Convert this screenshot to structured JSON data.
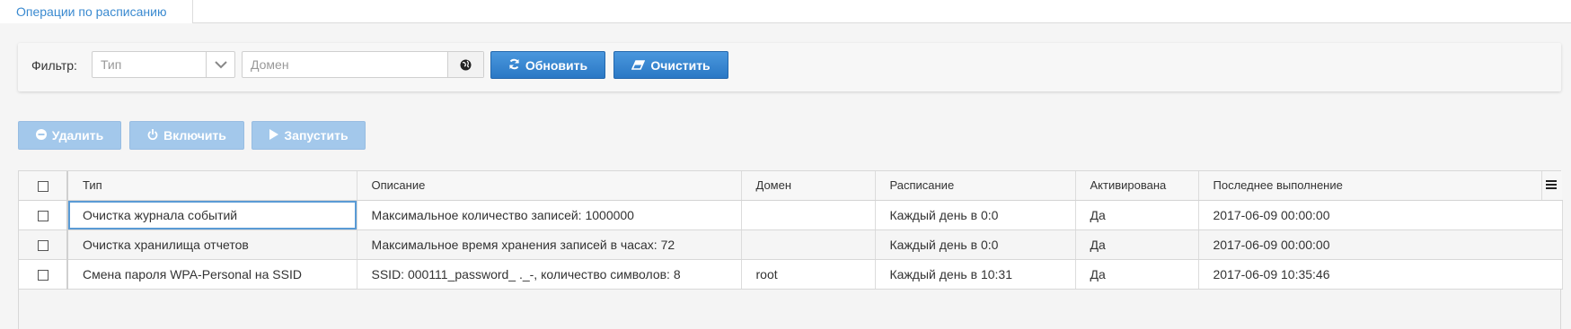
{
  "tab": {
    "label": "Операции по расписанию"
  },
  "filter": {
    "label": "Фильтр:",
    "type_placeholder": "Тип",
    "domain_placeholder": "Домен",
    "refresh_label": "Обновить",
    "clear_label": "Очистить"
  },
  "actions": {
    "delete_label": "Удалить",
    "enable_label": "Включить",
    "run_label": "Запустить"
  },
  "table": {
    "headers": {
      "type": "Тип",
      "description": "Описание",
      "domain": "Домен",
      "schedule": "Расписание",
      "activated": "Активирована",
      "last_run": "Последнее выполнение"
    },
    "rows": [
      {
        "type": "Очистка журнала событий",
        "description": "Максимальное количество записей: 1000000",
        "domain": "",
        "schedule": "Каждый день в 0:0",
        "activated": "Да",
        "last_run": "2017-06-09 00:00:00"
      },
      {
        "type": "Очистка хранилища отчетов",
        "description": "Максимальное время хранения записей в часах: 72",
        "domain": "",
        "schedule": "Каждый день в 0:0",
        "activated": "Да",
        "last_run": "2017-06-09 00:00:00"
      },
      {
        "type": "Смена пароля WPA-Personal на SSID",
        "description": "SSID: 000111_password_ ._-, количество символов: 8",
        "domain": "root",
        "schedule": "Каждый день в 10:31",
        "activated": "Да",
        "last_run": "2017-06-09 10:35:46"
      }
    ]
  },
  "colors": {
    "accent": "#3a8ad0",
    "button_primary": "#2f80cf",
    "button_disabled": "#a3c8eb"
  },
  "icons": {
    "type_dropdown": "chevron-down-icon",
    "domain_addon": "globe-icon",
    "refresh": "refresh-icon",
    "clear": "eraser-icon",
    "delete": "minus-circle-icon",
    "enable": "power-icon",
    "run": "play-icon",
    "columns": "menu-icon"
  }
}
